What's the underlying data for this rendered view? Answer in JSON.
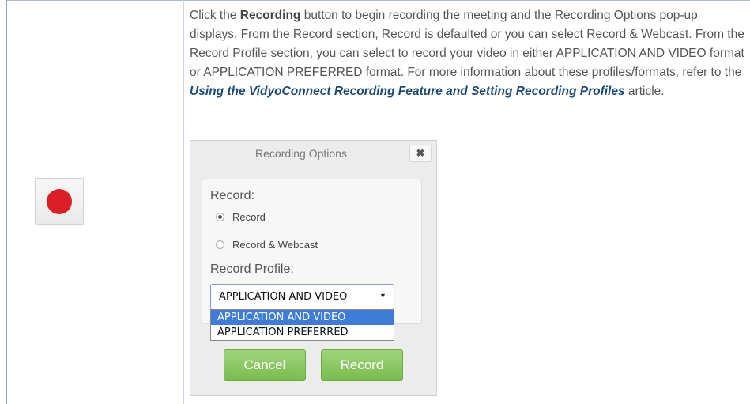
{
  "description": {
    "p1": "Click the ",
    "recording_word": "Recording",
    "p2": " button to begin recording the meeting and the Recording Options pop-up displays. From the Record section, Record is defaulted or you can select Record & Webcast. From the Record Profile section, you can select to record your video in either APPLICATION AND VIDEO format or APPLICATION PREFERRED format. For more information about these profiles/formats, refer to the ",
    "link": "Using the VidyoConnect Recording Feature and Setting Recording Profiles",
    "p3": " article."
  },
  "dialog": {
    "title": "Recording Options",
    "close_glyph": "✖",
    "record_label": "Record:",
    "record_options": [
      {
        "label": "Record",
        "checked": true
      },
      {
        "label": "Record & Webcast",
        "checked": false
      }
    ],
    "profile_label": "Record Profile:",
    "profile_selected": "APPLICATION AND VIDEO",
    "profile_options": [
      "APPLICATION AND VIDEO",
      "APPLICATION PREFERRED"
    ],
    "cancel_label": "Cancel",
    "record_button_label": "Record"
  },
  "colors": {
    "record_dot": "#dc1f26",
    "link": "#1b4a7a",
    "button_green": "#8ccb63",
    "dropdown_highlight": "#3e7cd9"
  }
}
